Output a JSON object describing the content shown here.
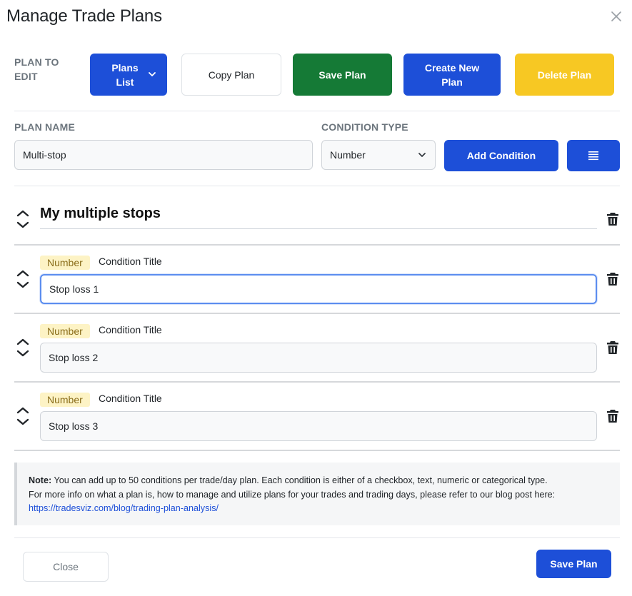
{
  "modal": {
    "title": "Manage Trade Plans",
    "close_icon": "close-icon"
  },
  "toolbar": {
    "plan_to_edit_label": "PLAN TO EDIT",
    "plans_list_label": "Plans List",
    "copy_plan_label": "Copy Plan",
    "save_plan_label": "Save Plan",
    "create_new_plan_label": "Create New Plan",
    "delete_plan_label": "Delete Plan"
  },
  "plan_form": {
    "plan_name_label": "PLAN NAME",
    "plan_name_value": "Multi-stop",
    "condition_type_label": "CONDITION TYPE",
    "condition_type_value": "Number",
    "add_condition_label": "Add Condition",
    "list_icon": "list-icon"
  },
  "group": {
    "title": "My multiple stops"
  },
  "conditions": [
    {
      "badge": "Number",
      "label": "Condition Title",
      "value": "Stop loss 1"
    },
    {
      "badge": "Number",
      "label": "Condition Title",
      "value": "Stop loss 2"
    },
    {
      "badge": "Number",
      "label": "Condition Title",
      "value": "Stop loss 3"
    }
  ],
  "note": {
    "bold": "Note:",
    "text_1": " You can add up to 50 conditions per trade/day plan. Each condition is either of a checkbox, text, numeric or categorical type.",
    "text_2": "For more info on what a plan is, how to manage and utilize plans for your trades and trading days, please refer to our blog post here:",
    "link": "https://tradesviz.com/blog/trading-plan-analysis/"
  },
  "footer": {
    "close_label": "Close",
    "save_plan_label": "Save Plan"
  },
  "colors": {
    "primary": "#1d4fd8",
    "success": "#157a36",
    "warning": "#f7c823",
    "badge_bg": "#fdf3c5",
    "badge_text": "#8a6d1a"
  }
}
